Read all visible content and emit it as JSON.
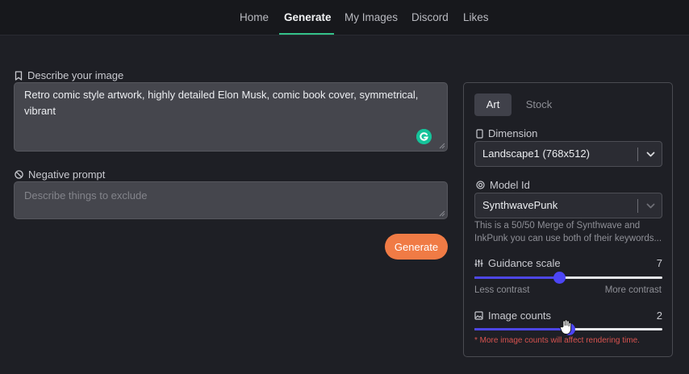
{
  "nav": {
    "items": [
      {
        "label": "Home",
        "active": false
      },
      {
        "label": "Generate",
        "active": true
      },
      {
        "label": "My Images",
        "active": false
      },
      {
        "label": "Discord",
        "active": false
      },
      {
        "label": "Likes",
        "active": false
      }
    ]
  },
  "prompt": {
    "label": "Describe your image",
    "value": "Retro comic style artwork, highly detailed Elon Musk, comic book cover, symmetrical, vibrant"
  },
  "negative": {
    "label": "Negative prompt",
    "placeholder": "Describe things to exclude"
  },
  "generate_label": "Generate",
  "settings": {
    "tabs": [
      {
        "label": "Art",
        "active": true
      },
      {
        "label": "Stock",
        "active": false
      }
    ],
    "dimension": {
      "label": "Dimension",
      "value": "Landscape1 (768x512)"
    },
    "model": {
      "label": "Model Id",
      "value": "SynthwavePunk",
      "description": "This is a 50/50 Merge of Synthwave and InkPunk you can use both of their keywords..."
    },
    "guidance": {
      "label": "Guidance scale",
      "value": "7",
      "level": 0.45,
      "min_hint": "Less contrast",
      "max_hint": "More contrast"
    },
    "image_counts": {
      "label": "Image counts",
      "value": "2",
      "level": 0.5,
      "warning": "* More image counts will affect rendering time."
    }
  },
  "colors": {
    "accent": "#f07b45",
    "slider": "#4c45f5",
    "active_tab_underline": "#34c28a"
  }
}
